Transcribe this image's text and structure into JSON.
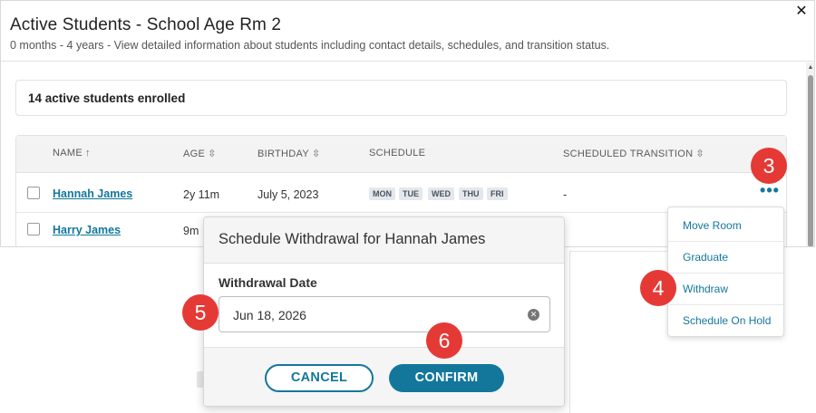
{
  "modal": {
    "title": "Active Students - School Age Rm 2",
    "subtitle": "0 months - 4 years - View detailed information about students including contact details, schedules, and transition status.",
    "close_label": "✕"
  },
  "summary": {
    "text": "14 active students enrolled"
  },
  "table": {
    "headers": {
      "name": "NAME",
      "age": "AGE",
      "birthday": "BIRTHDAY",
      "schedule": "SCHEDULE",
      "transition": "SCHEDULED TRANSITION"
    },
    "rows": [
      {
        "name": "Hannah James",
        "age": "2y 11m",
        "birthday": "July 5, 2023",
        "schedule": [
          "MON",
          "TUE",
          "WED",
          "THU",
          "FRI"
        ],
        "transition": "-"
      },
      {
        "name": "Harry James",
        "age": "9m"
      }
    ]
  },
  "menu": {
    "items": [
      "Move Room",
      "Graduate",
      "Withdraw",
      "Schedule On Hold"
    ]
  },
  "dialog": {
    "title": "Schedule Withdrawal for Hannah James",
    "field_label": "Withdrawal Date",
    "date_value": "Jun 18, 2026",
    "cancel_label": "CANCEL",
    "confirm_label": "CONFIRM"
  },
  "markers": [
    "3",
    "4",
    "5",
    "6"
  ],
  "colors": {
    "accent": "#13779c",
    "marker": "#e53935"
  }
}
